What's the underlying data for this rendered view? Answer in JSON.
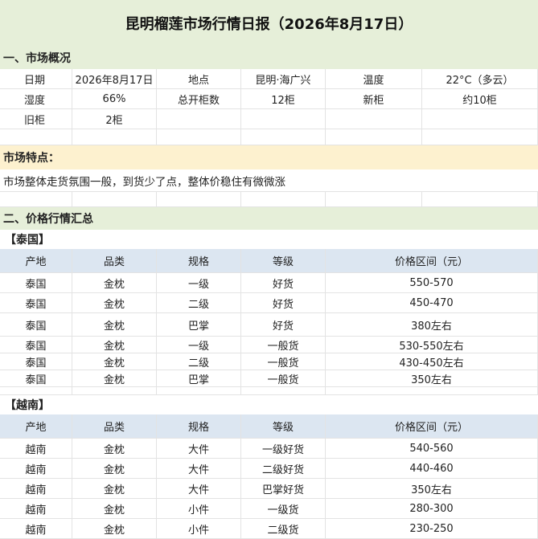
{
  "title": "昆明榴莲市场行情日报（2026年8月17日）",
  "overview": {
    "heading": "一、市场概况",
    "rows": [
      [
        "日期",
        "2026年8月17日",
        "地点",
        "昆明·海广兴",
        "温度",
        "22°C（多云）"
      ],
      [
        "湿度",
        "66%",
        "总开柜数",
        "12柜",
        "新柜",
        "约10柜"
      ],
      [
        "旧柜",
        "2柜",
        "",
        "",
        "",
        ""
      ]
    ]
  },
  "features": {
    "heading": "市场特点：",
    "text": "市场整体走货氛围一般，到货少了点，整体价稳住有微微涨"
  },
  "prices": {
    "heading": "二、价格行情汇总",
    "columns": [
      "产地",
      "品类",
      "规格",
      "等级",
      "价格区间（元）"
    ],
    "thailand": {
      "label": "【泰国】",
      "rows": [
        [
          "泰国",
          "金枕",
          "一级",
          "好货",
          "550-570"
        ],
        [
          "泰国",
          "金枕",
          "二级",
          "好货",
          "450-470"
        ],
        [
          "泰国",
          "金枕",
          "巴掌",
          "好货",
          "380左右"
        ],
        [
          "泰国",
          "金枕",
          "一级",
          "一般货",
          "530-550左右"
        ],
        [
          "泰国",
          "金枕",
          "二级",
          "一般货",
          "430-450左右"
        ],
        [
          "泰国",
          "金枕",
          "巴掌",
          "一般货",
          "350左右"
        ]
      ]
    },
    "vietnam": {
      "label": "【越南】",
      "rows": [
        [
          "越南",
          "金枕",
          "大件",
          "一级好货",
          "540-560"
        ],
        [
          "越南",
          "金枕",
          "大件",
          "二级好货",
          "440-460"
        ],
        [
          "越南",
          "金枕",
          "大件",
          "巴掌好货",
          "350左右"
        ],
        [
          "越南",
          "金枕",
          "小件",
          "一级货",
          "280-300"
        ],
        [
          "越南",
          "金枕",
          "小件",
          "二级货",
          "230-250"
        ]
      ]
    }
  }
}
